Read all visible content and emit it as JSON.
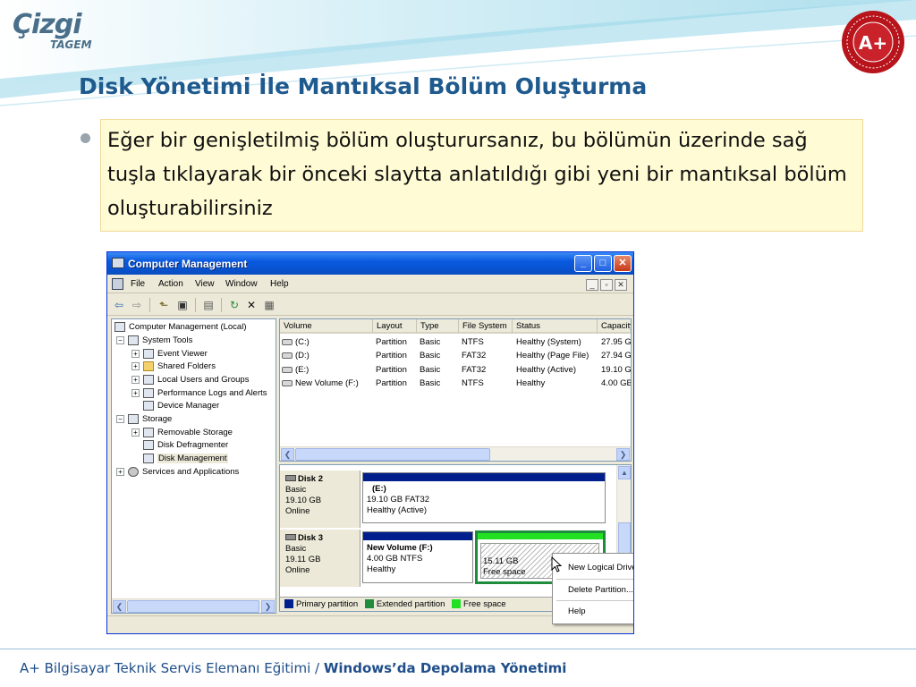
{
  "slide": {
    "logo_main": "Çizgi",
    "logo_sub": "TAGEM",
    "seal_text": "A+",
    "title": "Disk Yönetimi İle Mantıksal Bölüm Oluşturma",
    "bullet_text": "Eğer bir genişletilmiş bölüm oluşturursanız, bu bölümün üzerinde sağ tuşla tıklayarak bir önceki slaytta anlatıldığı gibi yeni bir mantıksal bölüm oluşturabilirsiniz",
    "footer_prefix": "A+ Bilgisayar Teknik Servis Elemanı Eğitimi / ",
    "footer_bold": "Windows’da Depolama Yönetimi",
    "colors": {
      "title": "#1f5a8e",
      "highlight_bg": "#fffbd4",
      "footer": "#1f4e8a"
    }
  },
  "window": {
    "title": "Computer Management",
    "menu": [
      "File",
      "Action",
      "View",
      "Window",
      "Help"
    ],
    "tree": {
      "root": "Computer Management (Local)",
      "system_tools": "System Tools",
      "event_viewer": "Event Viewer",
      "shared_folders": "Shared Folders",
      "local_users": "Local Users and Groups",
      "perf_logs": "Performance Logs and Alerts",
      "device_manager": "Device Manager",
      "storage": "Storage",
      "removable_storage": "Removable Storage",
      "disk_defrag": "Disk Defragmenter",
      "disk_management": "Disk Management",
      "services_apps": "Services and Applications"
    },
    "volumes": {
      "columns": [
        "Volume",
        "Layout",
        "Type",
        "File System",
        "Status",
        "Capacity"
      ],
      "rows": [
        [
          "(C:)",
          "Partition",
          "Basic",
          "NTFS",
          "Healthy (System)",
          "27.95 G"
        ],
        [
          "(D:)",
          "Partition",
          "Basic",
          "FAT32",
          "Healthy (Page File)",
          "27.94 G"
        ],
        [
          "(E:)",
          "Partition",
          "Basic",
          "FAT32",
          "Healthy (Active)",
          "19.10 G"
        ],
        [
          "New Volume (F:)",
          "Partition",
          "Basic",
          "NTFS",
          "Healthy",
          "4.00 GB"
        ]
      ]
    },
    "disks": {
      "disk2": {
        "name": "Disk 2",
        "kind": "Basic",
        "size": "19.10 GB",
        "state": "Online",
        "part_name": "(E:)",
        "part_info": "19.10 GB FAT32",
        "part_status": "Healthy (Active)"
      },
      "disk3": {
        "name": "Disk 3",
        "kind": "Basic",
        "size": "19.11 GB",
        "state": "Online",
        "part1_name": "New Volume  (F:)",
        "part1_info": "4.00 GB NTFS",
        "part1_status": "Healthy",
        "free_size": "15.11 GB",
        "free_label": "Free space"
      }
    },
    "legend": [
      "Primary partition",
      "Extended partition",
      "Free space"
    ],
    "legend_colors": [
      "#001e8c",
      "#1e8c3c",
      "#22e022"
    ],
    "context_menu": [
      "New Logical Drive...",
      "Delete Partition...",
      "Help"
    ]
  }
}
